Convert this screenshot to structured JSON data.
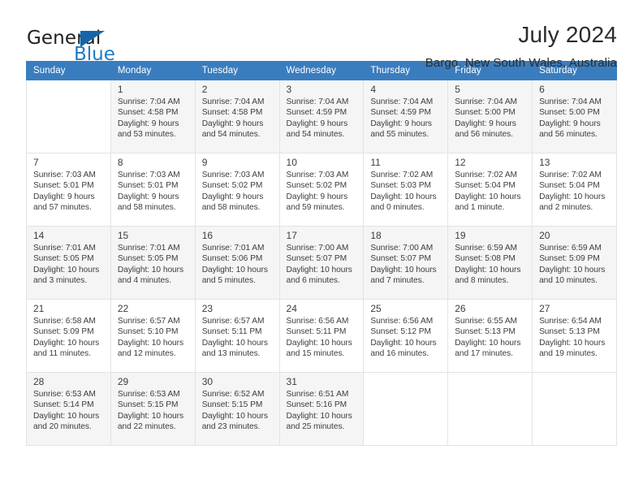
{
  "brand": {
    "name_top": "General",
    "name_bottom": "Blue",
    "triangle_color": "#1565a8",
    "blue_color": "#1e7ac4"
  },
  "header": {
    "title": "July 2024",
    "subtitle": "Bargo, New South Wales, Australia",
    "header_bg": "#3a7dbf"
  },
  "calendar": {
    "weekday_headers": [
      "Sunday",
      "Monday",
      "Tuesday",
      "Wednesday",
      "Thursday",
      "Friday",
      "Saturday"
    ],
    "weeks": [
      [
        {
          "day": "",
          "sunrise": "",
          "sunset": "",
          "daylight_1": "",
          "daylight_2": ""
        },
        {
          "day": "1",
          "sunrise": "Sunrise: 7:04 AM",
          "sunset": "Sunset: 4:58 PM",
          "daylight_1": "Daylight: 9 hours",
          "daylight_2": "and 53 minutes."
        },
        {
          "day": "2",
          "sunrise": "Sunrise: 7:04 AM",
          "sunset": "Sunset: 4:58 PM",
          "daylight_1": "Daylight: 9 hours",
          "daylight_2": "and 54 minutes."
        },
        {
          "day": "3",
          "sunrise": "Sunrise: 7:04 AM",
          "sunset": "Sunset: 4:59 PM",
          "daylight_1": "Daylight: 9 hours",
          "daylight_2": "and 54 minutes."
        },
        {
          "day": "4",
          "sunrise": "Sunrise: 7:04 AM",
          "sunset": "Sunset: 4:59 PM",
          "daylight_1": "Daylight: 9 hours",
          "daylight_2": "and 55 minutes."
        },
        {
          "day": "5",
          "sunrise": "Sunrise: 7:04 AM",
          "sunset": "Sunset: 5:00 PM",
          "daylight_1": "Daylight: 9 hours",
          "daylight_2": "and 56 minutes."
        },
        {
          "day": "6",
          "sunrise": "Sunrise: 7:04 AM",
          "sunset": "Sunset: 5:00 PM",
          "daylight_1": "Daylight: 9 hours",
          "daylight_2": "and 56 minutes."
        }
      ],
      [
        {
          "day": "7",
          "sunrise": "Sunrise: 7:03 AM",
          "sunset": "Sunset: 5:01 PM",
          "daylight_1": "Daylight: 9 hours",
          "daylight_2": "and 57 minutes."
        },
        {
          "day": "8",
          "sunrise": "Sunrise: 7:03 AM",
          "sunset": "Sunset: 5:01 PM",
          "daylight_1": "Daylight: 9 hours",
          "daylight_2": "and 58 minutes."
        },
        {
          "day": "9",
          "sunrise": "Sunrise: 7:03 AM",
          "sunset": "Sunset: 5:02 PM",
          "daylight_1": "Daylight: 9 hours",
          "daylight_2": "and 58 minutes."
        },
        {
          "day": "10",
          "sunrise": "Sunrise: 7:03 AM",
          "sunset": "Sunset: 5:02 PM",
          "daylight_1": "Daylight: 9 hours",
          "daylight_2": "and 59 minutes."
        },
        {
          "day": "11",
          "sunrise": "Sunrise: 7:02 AM",
          "sunset": "Sunset: 5:03 PM",
          "daylight_1": "Daylight: 10 hours",
          "daylight_2": "and 0 minutes."
        },
        {
          "day": "12",
          "sunrise": "Sunrise: 7:02 AM",
          "sunset": "Sunset: 5:04 PM",
          "daylight_1": "Daylight: 10 hours",
          "daylight_2": "and 1 minute."
        },
        {
          "day": "13",
          "sunrise": "Sunrise: 7:02 AM",
          "sunset": "Sunset: 5:04 PM",
          "daylight_1": "Daylight: 10 hours",
          "daylight_2": "and 2 minutes."
        }
      ],
      [
        {
          "day": "14",
          "sunrise": "Sunrise: 7:01 AM",
          "sunset": "Sunset: 5:05 PM",
          "daylight_1": "Daylight: 10 hours",
          "daylight_2": "and 3 minutes."
        },
        {
          "day": "15",
          "sunrise": "Sunrise: 7:01 AM",
          "sunset": "Sunset: 5:05 PM",
          "daylight_1": "Daylight: 10 hours",
          "daylight_2": "and 4 minutes."
        },
        {
          "day": "16",
          "sunrise": "Sunrise: 7:01 AM",
          "sunset": "Sunset: 5:06 PM",
          "daylight_1": "Daylight: 10 hours",
          "daylight_2": "and 5 minutes."
        },
        {
          "day": "17",
          "sunrise": "Sunrise: 7:00 AM",
          "sunset": "Sunset: 5:07 PM",
          "daylight_1": "Daylight: 10 hours",
          "daylight_2": "and 6 minutes."
        },
        {
          "day": "18",
          "sunrise": "Sunrise: 7:00 AM",
          "sunset": "Sunset: 5:07 PM",
          "daylight_1": "Daylight: 10 hours",
          "daylight_2": "and 7 minutes."
        },
        {
          "day": "19",
          "sunrise": "Sunrise: 6:59 AM",
          "sunset": "Sunset: 5:08 PM",
          "daylight_1": "Daylight: 10 hours",
          "daylight_2": "and 8 minutes."
        },
        {
          "day": "20",
          "sunrise": "Sunrise: 6:59 AM",
          "sunset": "Sunset: 5:09 PM",
          "daylight_1": "Daylight: 10 hours",
          "daylight_2": "and 10 minutes."
        }
      ],
      [
        {
          "day": "21",
          "sunrise": "Sunrise: 6:58 AM",
          "sunset": "Sunset: 5:09 PM",
          "daylight_1": "Daylight: 10 hours",
          "daylight_2": "and 11 minutes."
        },
        {
          "day": "22",
          "sunrise": "Sunrise: 6:57 AM",
          "sunset": "Sunset: 5:10 PM",
          "daylight_1": "Daylight: 10 hours",
          "daylight_2": "and 12 minutes."
        },
        {
          "day": "23",
          "sunrise": "Sunrise: 6:57 AM",
          "sunset": "Sunset: 5:11 PM",
          "daylight_1": "Daylight: 10 hours",
          "daylight_2": "and 13 minutes."
        },
        {
          "day": "24",
          "sunrise": "Sunrise: 6:56 AM",
          "sunset": "Sunset: 5:11 PM",
          "daylight_1": "Daylight: 10 hours",
          "daylight_2": "and 15 minutes."
        },
        {
          "day": "25",
          "sunrise": "Sunrise: 6:56 AM",
          "sunset": "Sunset: 5:12 PM",
          "daylight_1": "Daylight: 10 hours",
          "daylight_2": "and 16 minutes."
        },
        {
          "day": "26",
          "sunrise": "Sunrise: 6:55 AM",
          "sunset": "Sunset: 5:13 PM",
          "daylight_1": "Daylight: 10 hours",
          "daylight_2": "and 17 minutes."
        },
        {
          "day": "27",
          "sunrise": "Sunrise: 6:54 AM",
          "sunset": "Sunset: 5:13 PM",
          "daylight_1": "Daylight: 10 hours",
          "daylight_2": "and 19 minutes."
        }
      ],
      [
        {
          "day": "28",
          "sunrise": "Sunrise: 6:53 AM",
          "sunset": "Sunset: 5:14 PM",
          "daylight_1": "Daylight: 10 hours",
          "daylight_2": "and 20 minutes."
        },
        {
          "day": "29",
          "sunrise": "Sunrise: 6:53 AM",
          "sunset": "Sunset: 5:15 PM",
          "daylight_1": "Daylight: 10 hours",
          "daylight_2": "and 22 minutes."
        },
        {
          "day": "30",
          "sunrise": "Sunrise: 6:52 AM",
          "sunset": "Sunset: 5:15 PM",
          "daylight_1": "Daylight: 10 hours",
          "daylight_2": "and 23 minutes."
        },
        {
          "day": "31",
          "sunrise": "Sunrise: 6:51 AM",
          "sunset": "Sunset: 5:16 PM",
          "daylight_1": "Daylight: 10 hours",
          "daylight_2": "and 25 minutes."
        },
        {
          "day": "",
          "sunrise": "",
          "sunset": "",
          "daylight_1": "",
          "daylight_2": ""
        },
        {
          "day": "",
          "sunrise": "",
          "sunset": "",
          "daylight_1": "",
          "daylight_2": ""
        },
        {
          "day": "",
          "sunrise": "",
          "sunset": "",
          "daylight_1": "",
          "daylight_2": ""
        }
      ]
    ]
  }
}
